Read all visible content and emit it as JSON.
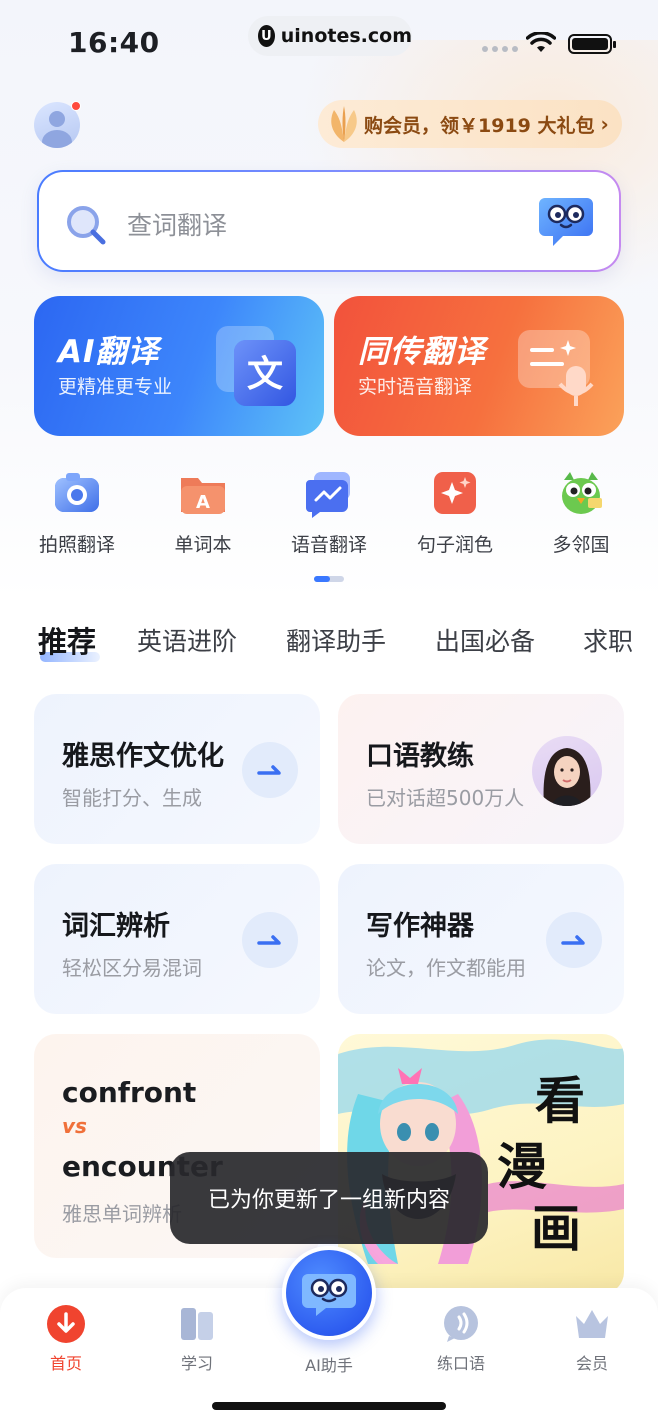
{
  "status_bar": {
    "time": "16:40",
    "url": "uinotes.com"
  },
  "header": {
    "vip_text": "购会员，领￥1919 大礼包",
    "vip_arrow": "›"
  },
  "search": {
    "placeholder": "查词翻译"
  },
  "features": [
    {
      "title": "AI翻译",
      "subtitle": "更精准更专业",
      "graphic_text": "文"
    },
    {
      "title": "同传翻译",
      "subtitle": "实时语音翻译"
    }
  ],
  "tools": [
    {
      "label": "拍照翻译",
      "icon": "camera-icon"
    },
    {
      "label": "单词本",
      "icon": "folder-a-icon"
    },
    {
      "label": "语音翻译",
      "icon": "voice-chat-icon"
    },
    {
      "label": "句子润色",
      "icon": "sparkle-icon"
    },
    {
      "label": "多邻国",
      "icon": "owl-icon"
    }
  ],
  "tabs": [
    "推荐",
    "英语进阶",
    "翻译助手",
    "出国必备",
    "求职"
  ],
  "cards": {
    "ielts": {
      "title": "雅思作文优化",
      "subtitle": "智能打分、生成"
    },
    "speaking": {
      "title": "口语教练",
      "subtitle": "已对话超500万人"
    },
    "vocab": {
      "title": "词汇辨析",
      "subtitle": "轻松区分易混词"
    },
    "writing": {
      "title": "写作神器",
      "subtitle": "论文，作文都能用"
    },
    "confront": {
      "word1": "confront",
      "vs": "vs",
      "word2": "encounter",
      "subtitle": "雅思单词辨析"
    },
    "manga": {
      "text_line1": "看",
      "text_line2": "漫",
      "text_line3": "画"
    }
  },
  "toast": {
    "text": "已为你更新了一组新内容"
  },
  "bottom_nav": [
    {
      "label": "首页",
      "active": true
    },
    {
      "label": "学习"
    },
    {
      "label": "AI助手"
    },
    {
      "label": "练口语"
    },
    {
      "label": "会员"
    }
  ],
  "colors": {
    "accent_blue": "#3a78ff",
    "accent_red": "#f0442f",
    "vip_brown": "#8b4a12"
  }
}
